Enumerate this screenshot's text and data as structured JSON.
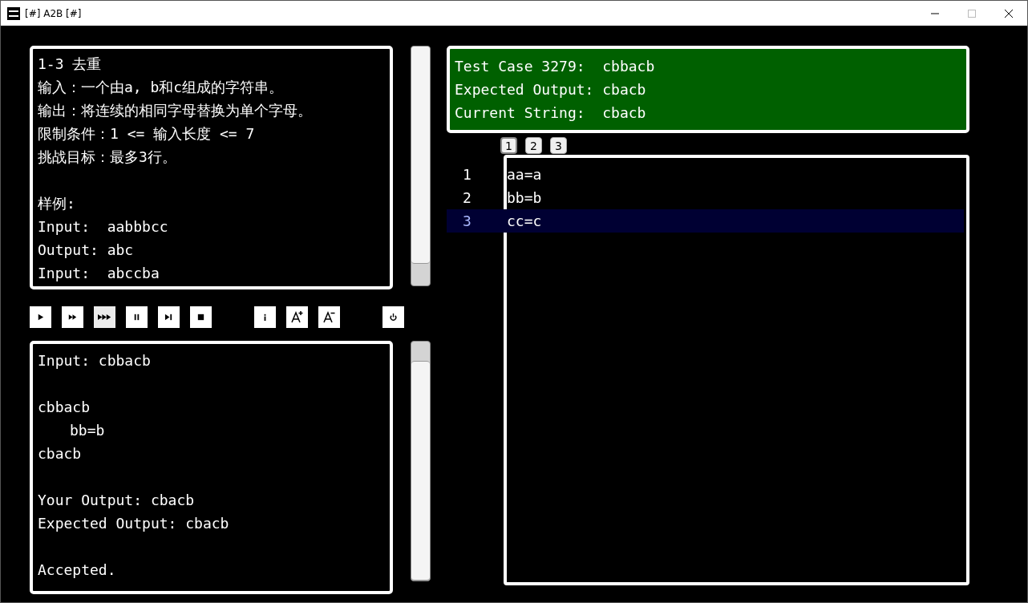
{
  "window": {
    "title": "[#] A2B [#]"
  },
  "problem": {
    "blocks": [
      [
        "1-3 去重",
        "输入：一个由a, b和c组成的字符串。",
        "输出：将连续的相同字母替换为单个字母。",
        "限制条件：1 <= 输入长度 <= 7",
        "挑战目标：最多3行。"
      ],
      [
        "样例:",
        "Input:  aabbbcc",
        "Output: abc",
        "Input:  abccba"
      ]
    ]
  },
  "controls": [
    {
      "kind": "play",
      "selected": false
    },
    {
      "kind": "fast",
      "selected": false
    },
    {
      "kind": "fastest",
      "selected": true
    },
    {
      "kind": "pause",
      "selected": false
    },
    {
      "kind": "step",
      "selected": false
    },
    {
      "kind": "stop",
      "selected": false
    },
    {
      "kind": "info",
      "selected": false
    },
    {
      "kind": "font-up",
      "selected": false
    },
    {
      "kind": "font-down",
      "selected": false
    },
    {
      "kind": "power",
      "selected": false
    }
  ],
  "output": {
    "blocks": [
      [
        {
          "text": "Input: cbbacb",
          "indent": false
        }
      ],
      [
        {
          "text": "cbbacb",
          "indent": false
        },
        {
          "text": "bb=b",
          "indent": true
        },
        {
          "text": "cbacb",
          "indent": false
        }
      ],
      [
        {
          "text": "Your Output: cbacb",
          "indent": false
        },
        {
          "text": "Expected Output: cbacb",
          "indent": false
        }
      ],
      [
        {
          "text": "Accepted.",
          "indent": false
        }
      ]
    ]
  },
  "status": {
    "passed": true,
    "lines": [
      "Test Case 3279:  cbbacb",
      "Expected Output: cbacb",
      "Current String:  cbacb"
    ]
  },
  "tabs": [
    {
      "label": "1",
      "selected": true
    },
    {
      "label": "2",
      "selected": false
    },
    {
      "label": "3",
      "selected": false
    }
  ],
  "code": [
    {
      "number": "1",
      "text": "aa=a",
      "selected": false
    },
    {
      "number": "2",
      "text": "bb=b",
      "selected": false
    },
    {
      "number": "3",
      "text": "cc=c",
      "selected": true
    }
  ]
}
